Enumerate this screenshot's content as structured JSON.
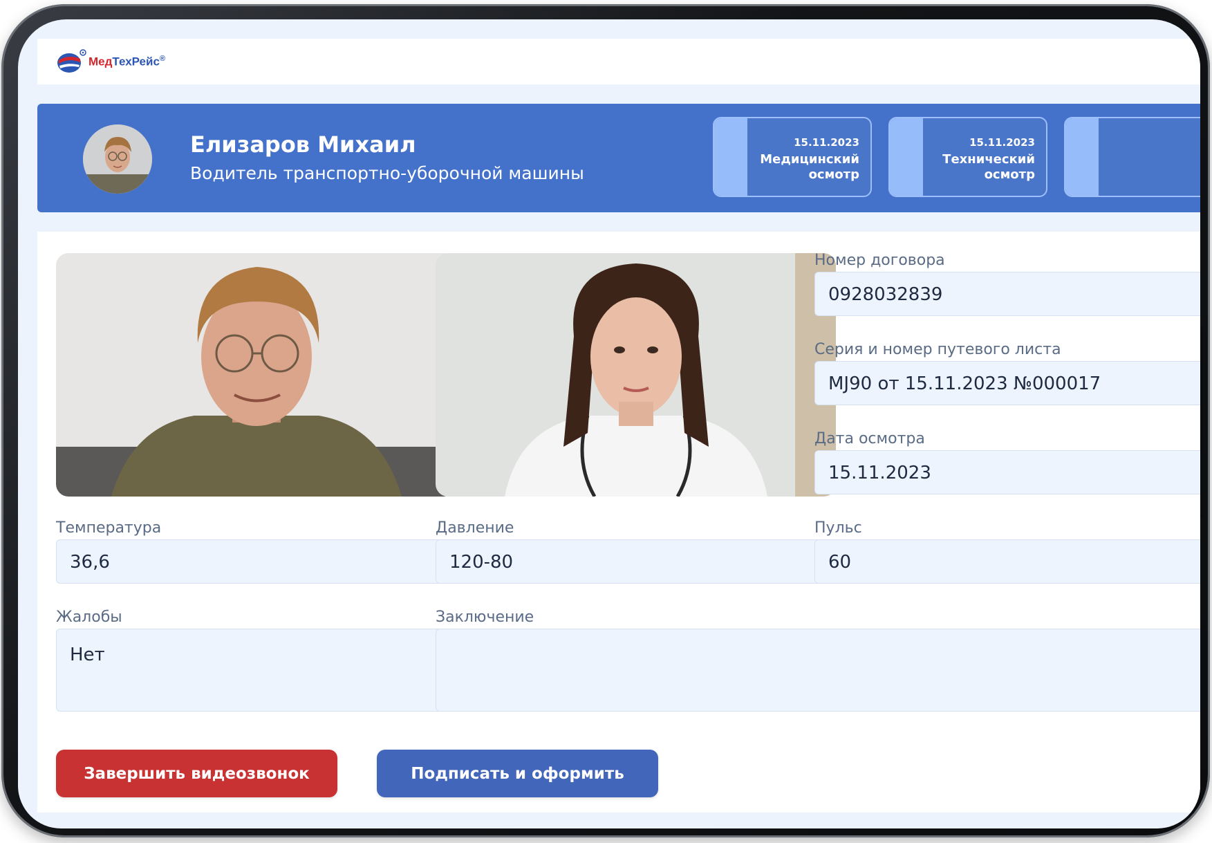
{
  "brand": {
    "name_part1": "Мед",
    "name_part2": "ТехРейс",
    "registered_mark": "®"
  },
  "profile": {
    "name": "Елизаров Михаил",
    "position": "Водитель транспортно-уборочной машины"
  },
  "exam_cards": [
    {
      "date": "15.11.2023",
      "title_line1": "Медицинский",
      "title_line2": "осмотр"
    },
    {
      "date": "15.11.2023",
      "title_line1": "Технический",
      "title_line2": "осмотр"
    }
  ],
  "form": {
    "contract_number": {
      "label": "Номер договора",
      "value": "0928032839"
    },
    "waybill": {
      "label": "Серия и номер путевого листа",
      "value": "MJ90 от 15.11.2023 №000017"
    },
    "exam_date": {
      "label": "Дата осмотра",
      "value": "15.11.2023"
    },
    "temperature": {
      "label": "Температура",
      "value": "36,6"
    },
    "pressure": {
      "label": "Давление",
      "value": "120-80"
    },
    "pulse": {
      "label": "Пульс",
      "value": "60"
    },
    "complaints": {
      "label": "Жалобы",
      "value": "Нет"
    },
    "conclusion": {
      "label": "Заключение",
      "value": ""
    }
  },
  "actions": {
    "end_call": "Завершить видеозвонок",
    "sign": "Подписать и оформить"
  },
  "colors": {
    "banner": "#4472cb",
    "end_call_button": "#c83232",
    "sign_button": "#4266b9",
    "field_background": "#eef4fd"
  }
}
